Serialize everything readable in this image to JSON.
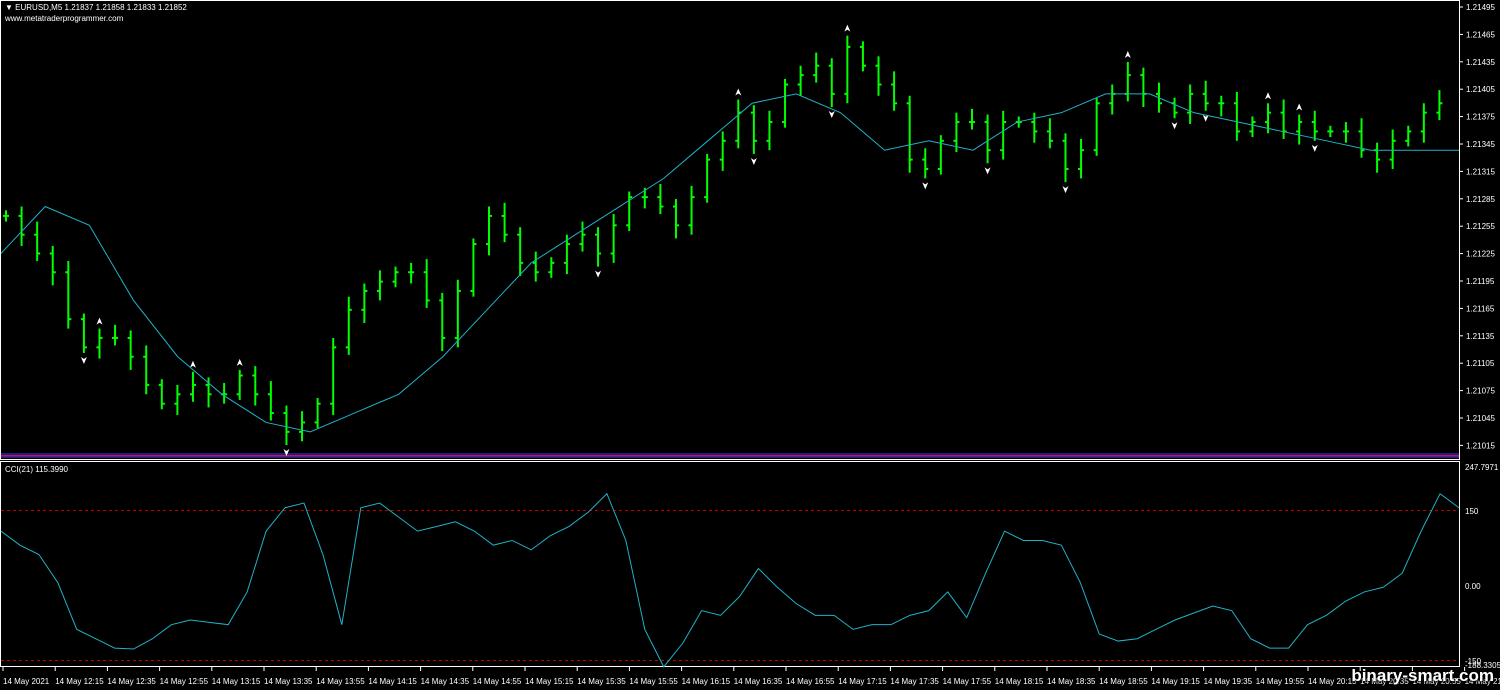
{
  "window": {
    "symbol_label": "EURUSD,M5",
    "ohlc": "1.21837 1.21858 1.21833 1.21852",
    "website": "www.metatraderprogrammer.com"
  },
  "indicator": {
    "title": "CCI(21) 115.3990",
    "max_label": "247.7971",
    "level_labels": [
      "150",
      "0.00",
      "-150"
    ],
    "min_label": "-188.3305"
  },
  "watermark": "binary-smart.com",
  "colors": {
    "background": "#000000",
    "candles": "#00ff00",
    "moving_average": "#20b2c8",
    "cci_line": "#20b2c8",
    "cci_levels": "#c00000",
    "axis": "#ffffff"
  },
  "price_axis_labels": [
    "1.21495",
    "1.21465",
    "1.21435",
    "1.21405",
    "1.21375",
    "1.21345",
    "1.21315",
    "1.21285",
    "1.21255",
    "1.21225",
    "1.21195",
    "1.21165",
    "1.21135",
    "1.21105",
    "1.21075",
    "1.21045",
    "1.21015"
  ],
  "time_axis_labels": [
    "14 May 2021",
    "14 May 12:15",
    "14 May 12:35",
    "14 May 12:55",
    "14 May 13:15",
    "14 May 13:35",
    "14 May 13:55",
    "14 May 14:15",
    "14 May 14:35",
    "14 May 14:55",
    "14 May 15:15",
    "14 May 15:35",
    "14 May 15:55",
    "14 May 16:15",
    "14 May 16:35",
    "14 May 16:55",
    "14 May 17:15",
    "14 May 17:35",
    "14 May 17:55",
    "14 May 18:15",
    "14 May 18:35",
    "14 May 18:55",
    "14 May 19:15",
    "14 May 19:35",
    "14 May 19:55",
    "14 May 20:15",
    "14 May 20:35",
    "14 May 20:55",
    "14 May 21:"
  ],
  "chart_data": [
    {
      "type": "line",
      "title": "EURUSD,M5",
      "subtitle": "1.21837 1.21858 1.21833 1.21852",
      "ylim": [
        1.2101,
        1.215
      ],
      "series": [
        {
          "values": [
            1.2127,
            1.2125,
            1.2123,
            1.2121,
            1.2116,
            1.2113,
            1.2114,
            1.2114,
            1.2112,
            1.2109,
            1.2107,
            1.2108,
            1.2109,
            1.2108,
            1.2108,
            1.211,
            1.2108,
            1.2106,
            1.2104,
            1.2105,
            1.2107,
            1.2113,
            1.2117,
            1.2119,
            1.212,
            1.2121,
            1.2121,
            1.2118,
            1.2114,
            1.2119,
            1.2124,
            1.2127,
            1.2125,
            1.2122,
            1.2121,
            1.2122,
            1.2124,
            1.2125,
            1.2123,
            1.2126,
            1.2129,
            1.2129,
            1.2128,
            1.2126,
            1.2129,
            1.2133,
            1.2135,
            1.2138,
            1.2135,
            1.2137,
            1.2141,
            1.2142,
            1.2143,
            1.214,
            1.2145,
            1.2143,
            1.2141,
            1.2139,
            1.2133,
            1.2132,
            1.2135,
            1.2137,
            1.2137,
            1.2134,
            1.2137,
            1.2137,
            1.2136,
            1.2135,
            1.2132,
            1.2134,
            1.2139,
            1.214,
            1.2142,
            1.214,
            1.2139,
            1.2138,
            1.214,
            1.2139,
            1.2139,
            1.2136,
            1.2137,
            1.2138,
            1.2136,
            1.2137,
            1.2136,
            1.2136,
            1.2136,
            1.2134,
            1.2133,
            1.2135,
            1.2136,
            1.2138,
            1.2139
          ]
        },
        {
          "values": [
            1.2123,
            1.2128,
            1.2126,
            1.2118,
            1.2112,
            1.2108,
            1.2105,
            1.2104,
            1.2106,
            1.2108,
            1.2112,
            1.2117,
            1.2122,
            1.2125,
            1.2128,
            1.2131,
            1.2135,
            1.2139,
            1.214,
            1.2138,
            1.2134,
            1.2135,
            1.2134,
            1.2137,
            1.2138,
            1.214,
            1.214,
            1.2138,
            1.2137,
            1.2136,
            1.2135,
            1.2134,
            1.2134,
            1.2134
          ]
        }
      ]
    },
    {
      "type": "line",
      "title": "CCI(21) 115.3990",
      "ylim": [
        -188.3305,
        247.7971
      ],
      "levels": [
        150,
        0,
        -150
      ],
      "series": [
        {
          "values": [
            100,
            70,
            50,
            -10,
            -110,
            -130,
            -150,
            -152,
            -130,
            -100,
            -90,
            -95,
            -100,
            -30,
            100,
            150,
            160,
            50,
            -100,
            150,
            160,
            130,
            100,
            110,
            120,
            100,
            70,
            80,
            60,
            90,
            110,
            140,
            180,
            80,
            -110,
            -190,
            -140,
            -70,
            -80,
            -40,
            20,
            -20,
            -55,
            -80,
            -80,
            -110,
            -100,
            -100,
            -80,
            -70,
            -30,
            -85,
            10,
            100,
            80,
            80,
            70,
            -10,
            -120,
            -135,
            -130,
            -110,
            -90,
            -75,
            -60,
            -70,
            -130,
            -150,
            -150,
            -100,
            -80,
            -50,
            -30,
            -20,
            10,
            100,
            180,
            150
          ]
        }
      ]
    }
  ]
}
